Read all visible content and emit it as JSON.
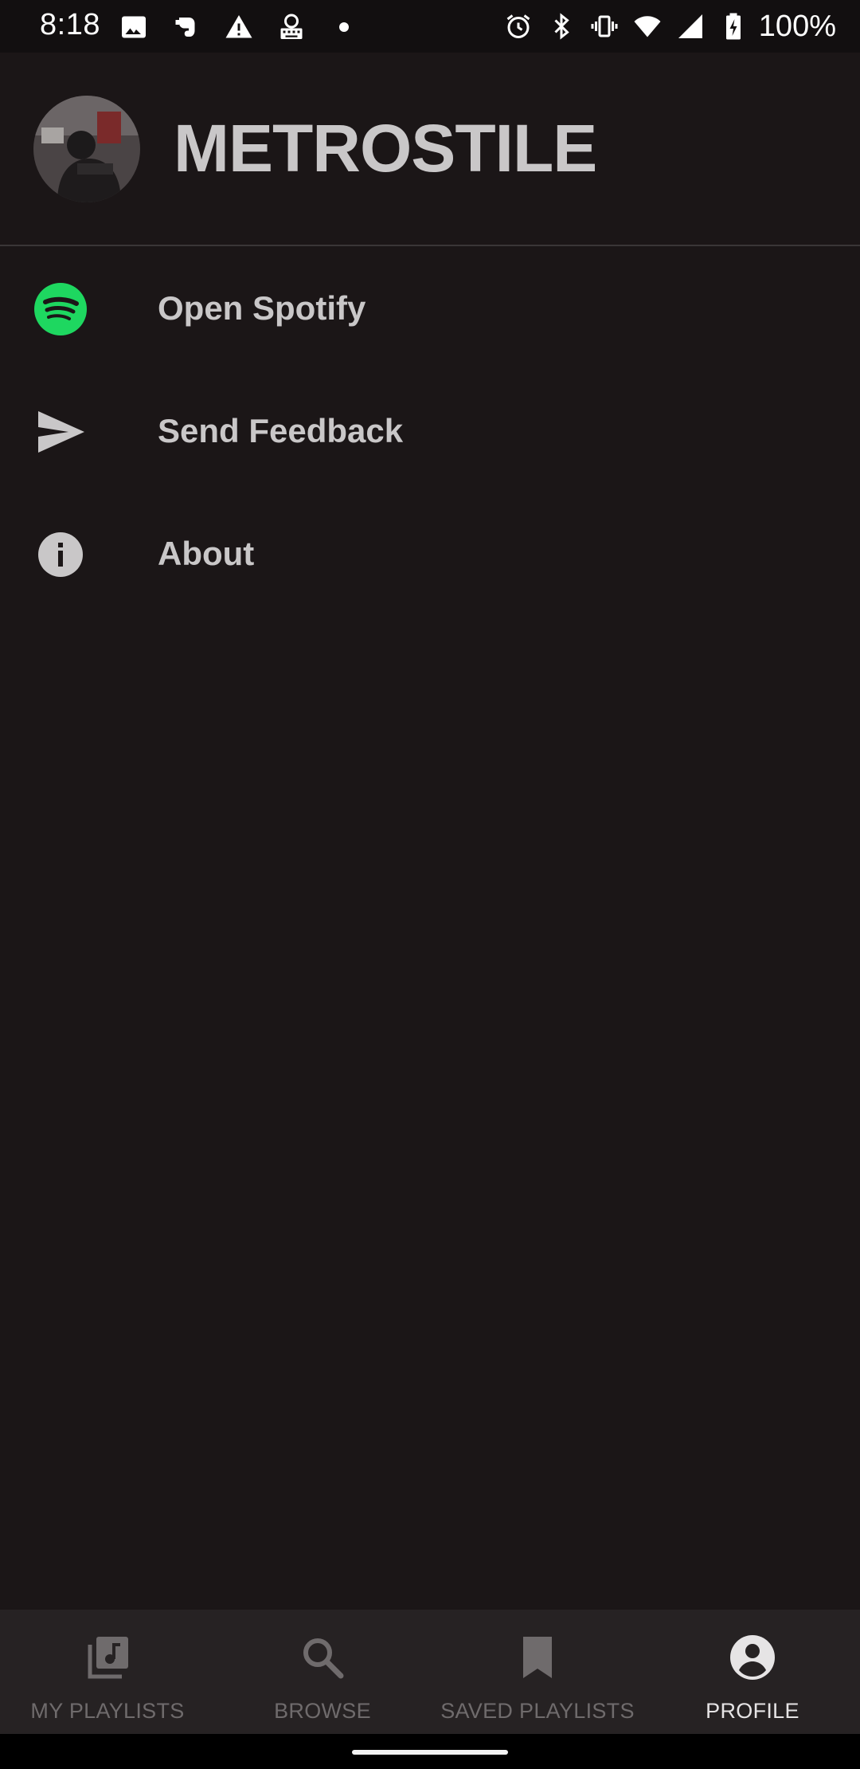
{
  "status_bar": {
    "time": "8:18",
    "battery_percent": "100%",
    "left_icons": [
      "image-icon",
      "evernote-icon",
      "warning-icon",
      "keyboard-icon",
      "dot-icon"
    ],
    "right_icons": [
      "alarm-icon",
      "bluetooth-icon",
      "vibrate-icon",
      "wifi-icon",
      "signal-icon",
      "battery-charging-icon"
    ]
  },
  "header": {
    "username": "METROSTILE",
    "avatar_icon": "avatar"
  },
  "menu": {
    "items": [
      {
        "label": "Open Spotify",
        "icon": "spotify-icon",
        "icon_color": "#1ed760"
      },
      {
        "label": "Send Feedback",
        "icon": "send-icon"
      },
      {
        "label": "About",
        "icon": "info-icon"
      }
    ]
  },
  "bottom_nav": {
    "active": "PROFILE",
    "items": [
      {
        "label": "MY PLAYLISTS",
        "icon": "playlist-library-icon"
      },
      {
        "label": "BROWSE",
        "icon": "search-icon"
      },
      {
        "label": "SAVED PLAYLISTS",
        "icon": "bookmark-icon"
      },
      {
        "label": "PROFILE",
        "icon": "account-circle-icon"
      }
    ]
  },
  "colors": {
    "background": "#1b1617",
    "status_bar": "#120f10",
    "text_primary": "#c9c7c8",
    "nav_background": "#262223",
    "nav_inactive": "#6f6b6c",
    "nav_active": "#e6e4e5",
    "spotify_green": "#1ed760"
  }
}
